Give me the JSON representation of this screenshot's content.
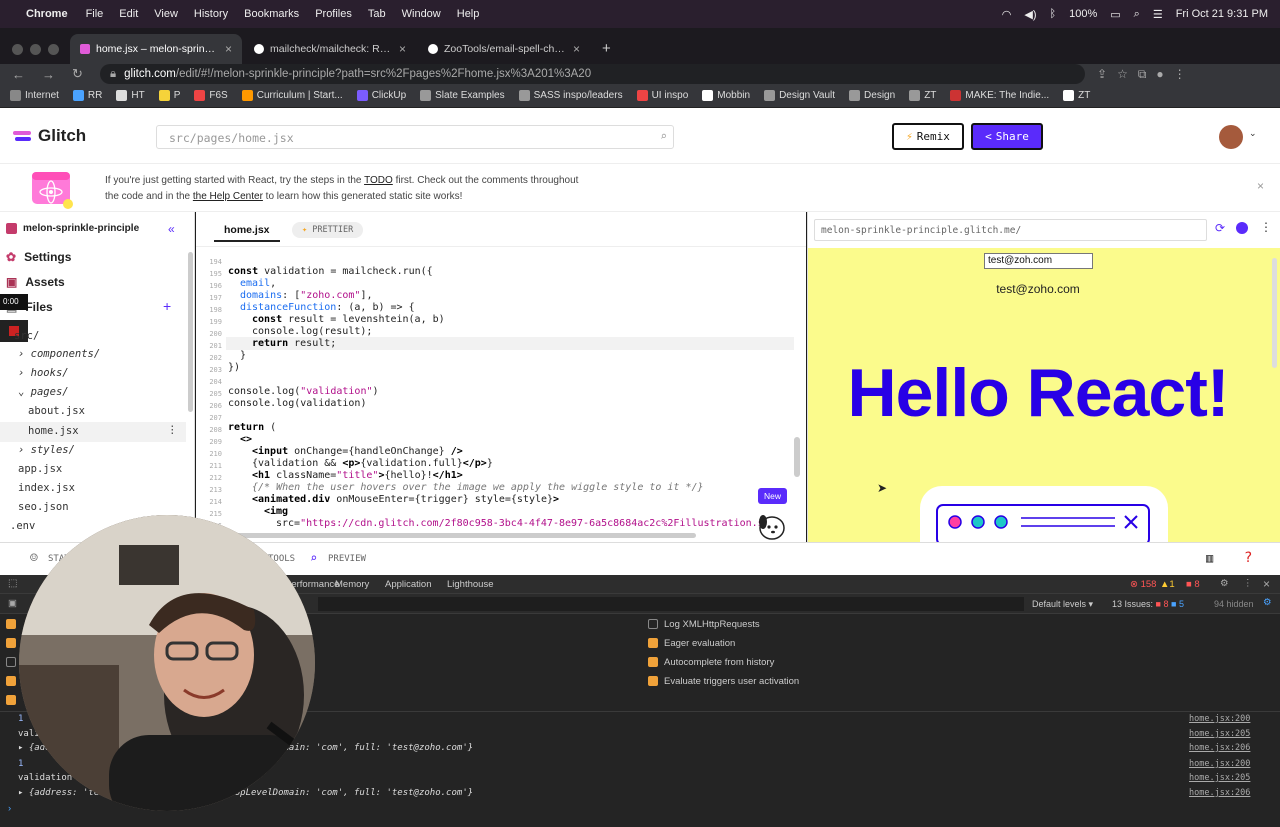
{
  "menubar": {
    "app": "Chrome",
    "items": [
      "File",
      "Edit",
      "View",
      "History",
      "Bookmarks",
      "Profiles",
      "Tab",
      "Window",
      "Help"
    ],
    "battery": "100%",
    "datetime": "Fri Oct 21  9:31 PM"
  },
  "tabs": [
    {
      "title": "home.jsx – melon-sprinkle-princ",
      "active": true
    },
    {
      "title": "mailcheck/mailcheck: Reduce",
      "active": false
    },
    {
      "title": "ZooTools/email-spell-checker:",
      "active": false
    }
  ],
  "address": {
    "domain": "glitch.com",
    "path": "/edit/#!/melon-sprinkle-principle?path=src%2Fpages%2Fhome.jsx%3A201%3A20"
  },
  "bookmarks": [
    "Internet",
    "RR",
    "HT",
    "P",
    "F6S",
    "Curriculum | Start...",
    "ClickUp",
    "Slate Examples",
    "SASS inspo/leaders",
    "UI inspo",
    "Mobbin",
    "Design Vault",
    "Design",
    "ZT",
    "MAKE: The Indie...",
    "ZT"
  ],
  "header": {
    "logo": "Glitch",
    "search_placeholder": "src/pages/home.jsx",
    "remix": "Remix",
    "share": "Share"
  },
  "banner": {
    "line1_pre": "If you're just getting started with React, try the steps in the ",
    "todo": "TODO",
    "line1_post": " first. Check out the comments throughout",
    "line2_pre": "the code and in the ",
    "help": "the Help Center",
    "line2_post": " to learn how this generated static site works!"
  },
  "sidebar": {
    "project": "melon-sprinkle-principle",
    "settings": "Settings",
    "assets": "Assets",
    "files": "Files",
    "timer": "0:00",
    "tree": [
      "src/",
      "components/",
      "hooks/",
      "pages/",
      "about.jsx",
      "home.jsx",
      "styles/",
      "app.jsx",
      "index.jsx",
      "seo.json",
      ".env"
    ]
  },
  "editor": {
    "tab": "home.jsx",
    "prettier": "PRETTIER",
    "new_badge": "New",
    "line_numbers": [
      "194",
      "195",
      "196",
      "197",
      "198",
      "199",
      "200",
      "201",
      "202",
      "203",
      "204",
      "205",
      "206",
      "207",
      "208",
      "209",
      "210",
      "211",
      "212",
      "213",
      "214",
      "215",
      "216"
    ]
  },
  "preview": {
    "url": "melon-sprinkle-principle.glitch.me/",
    "input_value": "test@zoh.com",
    "suggestion": "test@zoho.com",
    "heading": "Hello React!"
  },
  "status": {
    "stats": "STATUS",
    "tools": "TOOLS",
    "preview": "PREVIEW"
  },
  "devtools": {
    "tabs": [
      "Performance",
      "Memory",
      "Application",
      "Lighthouse"
    ],
    "errors": "158",
    "warnings": "1",
    "issues_count": "8",
    "default_levels": "Default levels",
    "issues": "13 Issues:",
    "issues_err": "8",
    "issues_info": "5",
    "hidden": "94 hidden",
    "settings": [
      "Log XMLHttpRequests",
      "Eager evaluation",
      "Autocomplete from history",
      "Evaluate triggers user activation"
    ],
    "logs": [
      {
        "text": "1",
        "src": "home.jsx:200"
      },
      {
        "text": "validation",
        "src": "home.jsx:205"
      },
      {
        "text": "▸ {address: 'test', domain: 'zoh.com', topLevelDomain: 'com', full: 'test@zoho.com'}",
        "src": "home.jsx:206"
      },
      {
        "text": "1",
        "src": "home.jsx:200"
      },
      {
        "text": "validation",
        "src": "home.jsx:205"
      },
      {
        "text": "▸ {address: 'test', domain: 'zoh.com', topLevelDomain: 'com', full: 'test@zoho.com'}",
        "src": "home.jsx:206"
      }
    ]
  }
}
